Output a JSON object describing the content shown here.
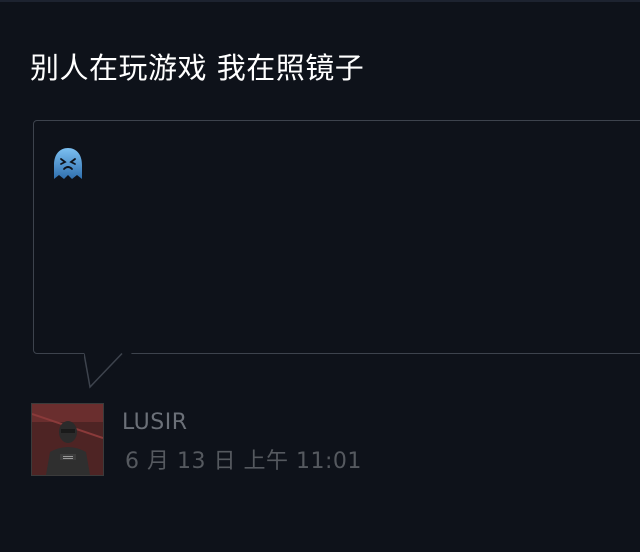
{
  "post": {
    "title": "别人在玩游戏 我在照镜子",
    "emoticon": "ghost-emoticon-icon"
  },
  "author": {
    "name": "LUSIR",
    "avatar": "avatar-figure",
    "timestamp": "6 月 13 日 上午 11:01"
  },
  "colors": {
    "background": "#0e121a",
    "bubble_border": "#3d434d",
    "title_text": "#ffffff",
    "author_text": "#6b7078",
    "timestamp_text": "#55595f",
    "emoticon_blue": "#4a8fcf"
  }
}
